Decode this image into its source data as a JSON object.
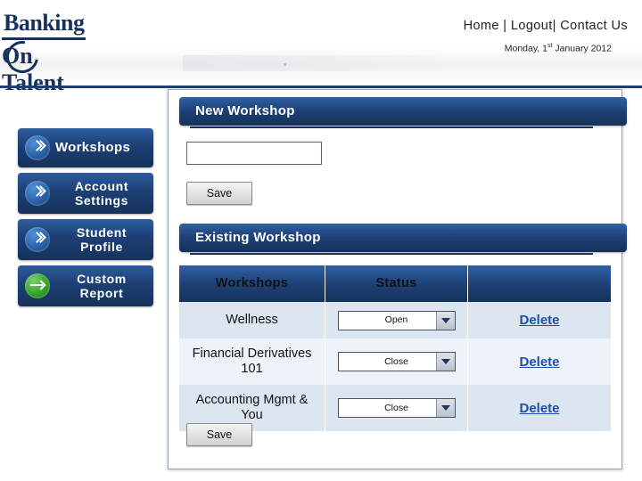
{
  "header": {
    "logo_line1": "Banking",
    "logo_line2": "On Talent",
    "nav": {
      "home": "Home",
      "sep1": "|",
      "logout": "Logout|",
      "contact": "Contact Us"
    },
    "date": "Monday, 1",
    "date_sup": "st",
    "date_rest": " January 2012"
  },
  "sidebar": {
    "items": [
      {
        "label": "Workshops",
        "icon": "chevron-circle-icon",
        "icon_color": "#2b62a8"
      },
      {
        "label": "Account Settings",
        "icon": "chevron-circle-icon",
        "icon_color": "#2b62a8"
      },
      {
        "label": "Student Profile",
        "icon": "chevron-circle-icon",
        "icon_color": "#2b62a8"
      },
      {
        "label": "Custom Report",
        "icon": "arrow-circle-icon",
        "icon_color": "#35a02b"
      }
    ]
  },
  "panel": {
    "new_workshop": {
      "title": "New Workshop",
      "input_value": "",
      "input_placeholder": "",
      "save_label": "Save"
    },
    "existing_workshop": {
      "title": "Existing Workshop",
      "save_label": "Save",
      "columns": [
        "Workshops",
        "Status",
        ""
      ],
      "rows": [
        {
          "workshop": "Wellness",
          "status": "Open",
          "action": "Delete"
        },
        {
          "workshop": "Financial Derivatives 101",
          "status": "Close",
          "action": "Delete"
        },
        {
          "workshop": "Accounting Mgmt & You",
          "status": "Close",
          "action": "Delete"
        }
      ]
    }
  },
  "colors": {
    "brand_dark": "#16325c",
    "brand_mid": "#2f61a4",
    "row_odd": "#dce6f1",
    "row_even": "#eef3fa",
    "link": "#1f4fa8"
  }
}
